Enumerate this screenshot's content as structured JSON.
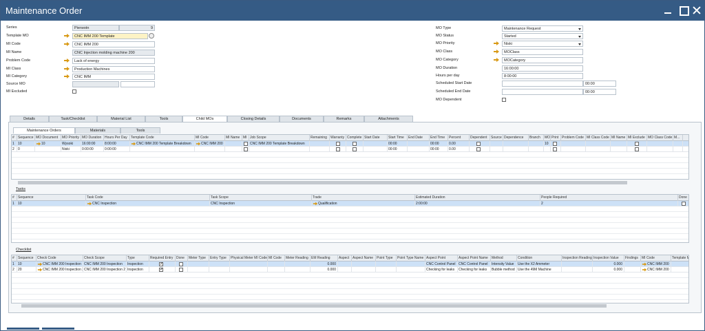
{
  "window": {
    "title": "Maintenance Order"
  },
  "left_form": {
    "series": {
      "label": "Series",
      "value": "Pierwotn",
      "num": "9"
    },
    "template_mo": {
      "label": "Template MO",
      "value": "CNC IMM 200 Template"
    },
    "mi_code": {
      "label": "MI Code",
      "value": "CNC IMM 200"
    },
    "mi_name": {
      "label": "MI Name",
      "value": "CNC Injection molding machine 200"
    },
    "problem_code": {
      "label": "Problem Code",
      "value": "Lack of energy"
    },
    "mi_class": {
      "label": "MI Class",
      "value": "Production Machines"
    },
    "mi_category": {
      "label": "MI Category",
      "value": "CNC IMM"
    },
    "source_mo": {
      "label": "Source MO",
      "value": ""
    },
    "mi_excluded": {
      "label": "MI Excluded"
    }
  },
  "right_form": {
    "mo_type": {
      "label": "MO Type",
      "value": "Maintenance Request"
    },
    "mo_status": {
      "label": "MO Status",
      "value": "Started"
    },
    "mo_priority": {
      "label": "MO Priority",
      "value": "Niski"
    },
    "mo_class": {
      "label": "MO Class",
      "value": "MOClass"
    },
    "mo_category": {
      "label": "MO Category",
      "value": "MOCategory"
    },
    "mo_duration": {
      "label": "MO Duration",
      "value": "16:00:00"
    },
    "hours_per_day": {
      "label": "Hours per day",
      "value": "8:00:00"
    },
    "sched_start": {
      "label": "Scheduled Start Date",
      "time": "00:00"
    },
    "sched_end": {
      "label": "Scheduled End Date",
      "time": "00:00"
    },
    "mo_dependent": {
      "label": "MO Dependent"
    }
  },
  "tabs": [
    "Details",
    "Task/Checklist",
    "Material List",
    "Tools",
    "Child MOs",
    "Closing Details",
    "Documents",
    "Remarks",
    "Attachments"
  ],
  "subtabs": [
    "Maintenance Orders",
    "Materials",
    "Tools"
  ],
  "mo_grid": {
    "headers": [
      "#",
      "Sequence",
      "MO Document",
      "MO Priority",
      "MO Duration",
      "Hours Per Day",
      "Template Code",
      "MI Code",
      "MI Name",
      "MI",
      "Job Scope",
      "Remaining",
      "Warranty",
      "Complete",
      "Start Date",
      "Start Time",
      "End Date",
      "End Time",
      "Percent",
      "Dependent",
      "Source",
      "Dependence",
      "Branch",
      "MO",
      "Print",
      "Problem Code",
      "MI Class Code",
      "MI Name",
      "MI Exclude",
      "MO Class Code",
      "M..."
    ],
    "rows": [
      {
        "n": "1",
        "seq": "10",
        "doc": "10",
        "prio": "Wysoki",
        "dur": "16:00:00",
        "hpd": "8:00:00",
        "tpl": "CNC IMM 200 Template Breakdown",
        "mi": "CNC IMM 200",
        "job": "CNC IMM 200 Template Breakdown",
        "stime": "00:00",
        "etime": "00:00",
        "pct": "0.00",
        "mo": "10"
      },
      {
        "n": "2",
        "seq": "0",
        "doc": "",
        "prio": "Niski",
        "dur": "0:00:00",
        "hpd": "0:00:00",
        "tpl": "",
        "mi": "",
        "job": "",
        "stime": "00:00",
        "etime": "00:00",
        "pct": "0.00",
        "mo": ""
      }
    ]
  },
  "tasks": {
    "title": "Tasks",
    "headers": [
      "#",
      "Sequence",
      "Task Code",
      "Task Scope",
      "Trade",
      "Estimated Duration",
      "People Required",
      "Done"
    ],
    "rows": [
      {
        "n": "1",
        "seq": "10",
        "code": "CNC Inspection",
        "scope": "CNC Inspection",
        "trade": "Qualification",
        "dur": "2:00:00",
        "people": "2"
      }
    ]
  },
  "checklist": {
    "title": "Checklist",
    "headers": [
      "#",
      "Sequence",
      "Check Code",
      "Check Scope",
      "Type",
      "Required Entry",
      "Done",
      "Meter Type",
      "Entry Type",
      "Physical Meter MI Code",
      "MI Code",
      "Meter Reading",
      "EM Reading",
      "Aspect",
      "Aspect Name",
      "Point Type",
      "Point Type Name",
      "Aspect Point",
      "Aspect Point Name",
      "Method",
      "Condition",
      "Inspection Reading",
      "Inspection Value",
      "Findings",
      "MI Code",
      "Template MO",
      "M"
    ],
    "rows": [
      {
        "n": "1",
        "seq": "10",
        "code": "CNC IMM 200 Inspection",
        "scope": "CNC IMM 200 Inspection",
        "type": "Inspection",
        "em": "0.000",
        "ap": "CNC Control Panel",
        "apn": "CNC Control Panel",
        "method": "Intensity Value",
        "cond": "Use the X2 Ammeter",
        "iv": "0.000",
        "mi": "CNC IMM 200",
        "m": "W"
      },
      {
        "n": "2",
        "seq": "20",
        "code": "CNC IMM 200 Inspection 2",
        "scope": "CNC IMM 200 Inspection 2",
        "type": "Inspection",
        "em": "0.000",
        "ap": "Checking for leaks",
        "apn": "Checking for leaks",
        "method": "Bubble method",
        "cond": "Use the 49M Machine",
        "iv": "0.000",
        "mi": "CNC IMM 200",
        "m": "W"
      }
    ]
  },
  "colors": {
    "titlebar": "#355b85",
    "selection": "#cde1f7",
    "arrow": "#d99a16"
  }
}
